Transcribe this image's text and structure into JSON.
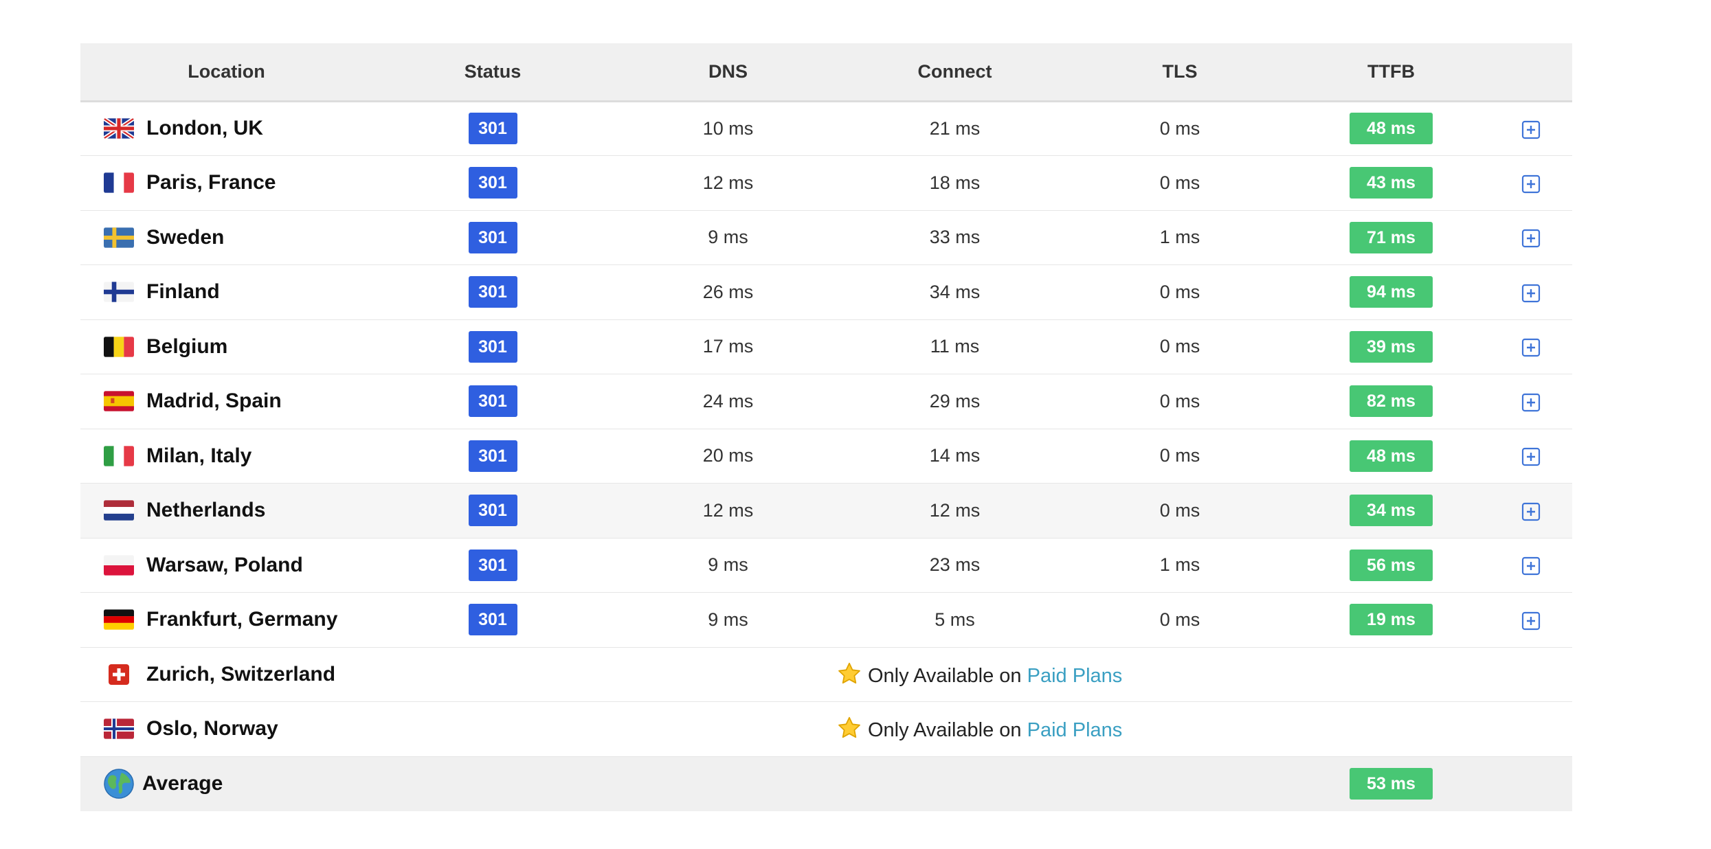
{
  "headers": {
    "location": "Location",
    "status": "Status",
    "dns": "DNS",
    "connect": "Connect",
    "tls": "TLS",
    "ttfb": "TTFB"
  },
  "rows": [
    {
      "flag": "uk-flag-icon",
      "location": "London, UK",
      "status": "301",
      "dns": "10 ms",
      "connect": "21 ms",
      "tls": "0 ms",
      "ttfb": "48 ms"
    },
    {
      "flag": "france-flag-icon",
      "location": "Paris, France",
      "status": "301",
      "dns": "12 ms",
      "connect": "18 ms",
      "tls": "0 ms",
      "ttfb": "43 ms"
    },
    {
      "flag": "sweden-flag-icon",
      "location": "Sweden",
      "status": "301",
      "dns": "9 ms",
      "connect": "33 ms",
      "tls": "1 ms",
      "ttfb": "71 ms"
    },
    {
      "flag": "finland-flag-icon",
      "location": "Finland",
      "status": "301",
      "dns": "26 ms",
      "connect": "34 ms",
      "tls": "0 ms",
      "ttfb": "94 ms"
    },
    {
      "flag": "belgium-flag-icon",
      "location": "Belgium",
      "status": "301",
      "dns": "17 ms",
      "connect": "11 ms",
      "tls": "0 ms",
      "ttfb": "39 ms"
    },
    {
      "flag": "spain-flag-icon",
      "location": "Madrid, Spain",
      "status": "301",
      "dns": "24 ms",
      "connect": "29 ms",
      "tls": "0 ms",
      "ttfb": "82 ms"
    },
    {
      "flag": "italy-flag-icon",
      "location": "Milan, Italy",
      "status": "301",
      "dns": "20 ms",
      "connect": "14 ms",
      "tls": "0 ms",
      "ttfb": "48 ms"
    },
    {
      "flag": "netherlands-flag-icon",
      "location": "Netherlands",
      "status": "301",
      "dns": "12 ms",
      "connect": "12 ms",
      "tls": "0 ms",
      "ttfb": "34 ms"
    },
    {
      "flag": "poland-flag-icon",
      "location": "Warsaw, Poland",
      "status": "301",
      "dns": "9 ms",
      "connect": "23 ms",
      "tls": "1 ms",
      "ttfb": "56 ms"
    },
    {
      "flag": "germany-flag-icon",
      "location": "Frankfurt, Germany",
      "status": "301",
      "dns": "9 ms",
      "connect": "5 ms",
      "tls": "0 ms",
      "ttfb": "19 ms"
    }
  ],
  "locked_rows": [
    {
      "flag": "switzerland-flag-icon",
      "location": "Zurich, Switzerland",
      "prefix": "Only Available on ",
      "link": "Paid Plans"
    },
    {
      "flag": "norway-flag-icon",
      "location": "Oslo, Norway",
      "prefix": "Only Available on ",
      "link": "Paid Plans"
    }
  ],
  "average": {
    "label": "Average",
    "ttfb": "53 ms",
    "icon": "globe-icon"
  },
  "colors": {
    "status_badge": "#2f5fe0",
    "ttfb_badge": "#48c774",
    "link": "#3a9fc2",
    "header_bg": "#f0f0f0",
    "expand_icon": "#3f74d8"
  }
}
